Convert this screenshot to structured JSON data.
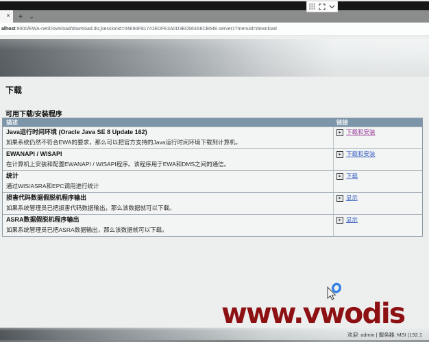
{
  "browser": {
    "tab_close_glyph": "×",
    "new_tab_glyph": "+",
    "tab_chevron_glyph": "⌄",
    "url_host": "alhost",
    "url_rest": ":9000/EWA-net/Download/download.do;jsessionid=04E90F81741EDFE3A0D3ED663A6CB64E.server1?menuid=download",
    "url_full": "alhost:9000/EWA-net/Download/download.do;jsessionid=04E90F81741EDFE3A0D3ED663A6CB64E.server1?menuid=download"
  },
  "page": {
    "title": "下载",
    "section_title": "可用下载/安装程序",
    "table": {
      "headers": [
        "描述",
        "链接"
      ],
      "go_icon_glyph": "▸",
      "rows": [
        {
          "title": "Java运行时间环境 (Oracle Java SE 8 Update 162)",
          "description": "如果系统仍然不符合EWA的要求，那么可以把官方支持的Java运行时间环境下载到计算机。",
          "link": "下载和安装",
          "link_color": "#993d99"
        },
        {
          "title": "EWANAPI / WISAPI",
          "description": "在计算机上安装和配置EWANAPI / WISAPI程序。该程序用于EWA和DMS之间的通信。",
          "link": "下载和安装",
          "link_color": "#3b62c3"
        },
        {
          "title": "统计",
          "description": "通过WIS/ASRA和EPC调用进行统计",
          "link": "下载",
          "link_color": "#3b62c3"
        },
        {
          "title": "损害代码数据假脱机程序输出",
          "description": "如果系统管理员已把损害代码数据输出，那么该数据就可以下载。",
          "link": "显示",
          "link_color": "#3b62c3"
        },
        {
          "title": "ASRA数据假脱机程序输出",
          "description": "如果系统管理员已把ASRA数据输出，那么该数据就可以下载。",
          "link": "显示",
          "link_color": "#3b62c3"
        }
      ]
    }
  },
  "watermark": {
    "text": "www.vwodis",
    "color": "#8d1013"
  },
  "statusbar": {
    "text": "欢迎:  admin | 服务器:  MSI (192.1",
    "user": "admin",
    "server": "MSI (192.1"
  },
  "colors": {
    "table_header_bg": "#7d95a8",
    "link_blue": "#3b62c3",
    "link_visited_purple": "#993d99",
    "spinner_blue": "#2e7fe6",
    "watermark_red": "#8d1013"
  }
}
